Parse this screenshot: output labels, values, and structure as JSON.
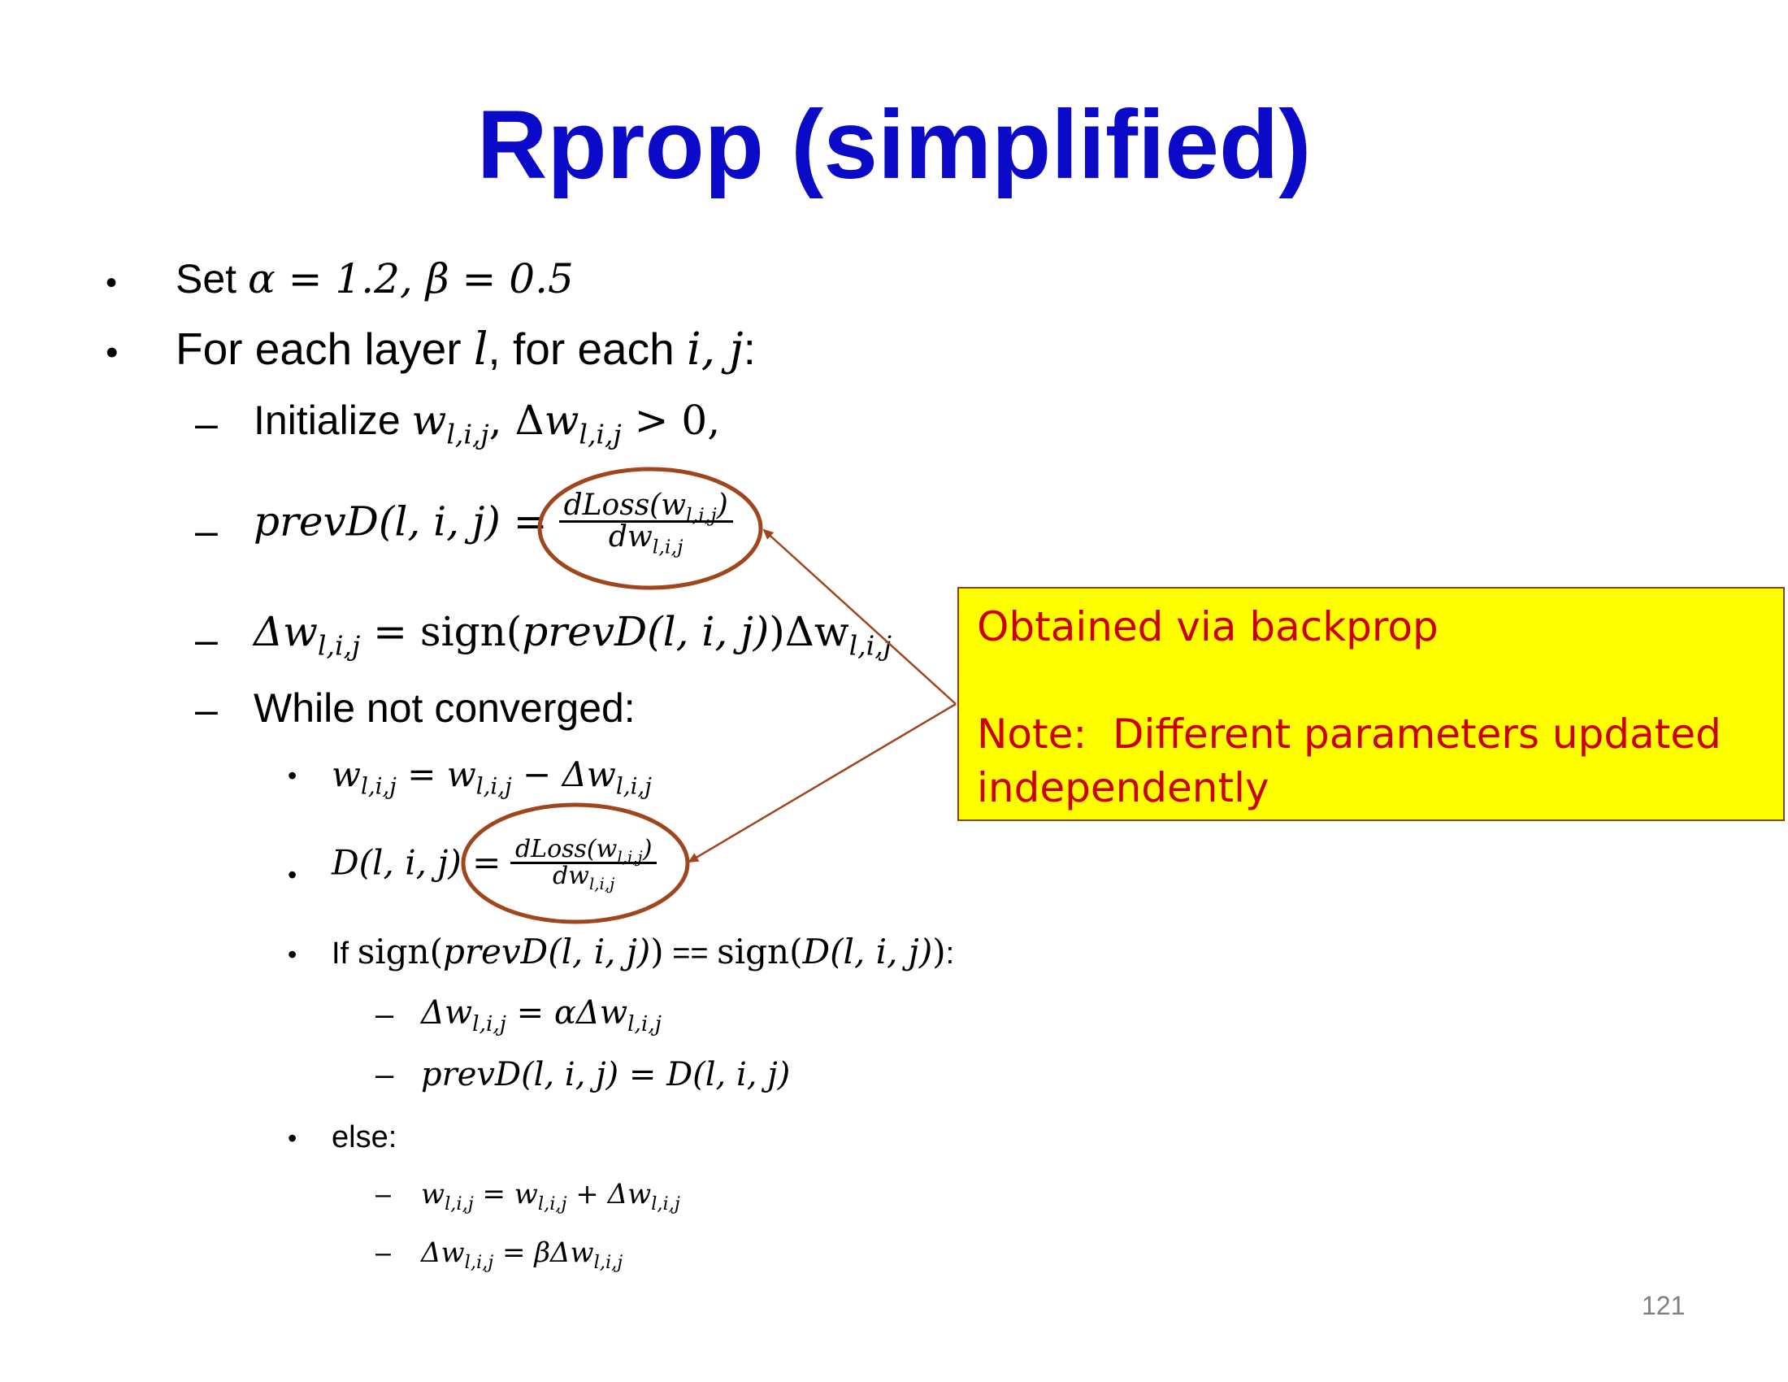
{
  "title": "Rprop (simplified)",
  "bullet_symbol": "•",
  "dash_symbol": "–",
  "lines": {
    "l1_prefix": "Set ",
    "l1_math": "α = 1.2, β = 0.5",
    "l2_a": "For each layer ",
    "l2_b": "l",
    "l2_c": ", for each ",
    "l2_d": "i, j",
    "l2_e": ":",
    "l3_prefix": "Initialize ",
    "l3_w": "w",
    "l3_sep": ", Δ",
    "l3_w2": "w",
    "l3_tail": " > 0,",
    "lij": "l,i,j",
    "l4_left": "prevD(l, i, j) =",
    "frac_num_a": "dLoss(w",
    "frac_num_b": ")",
    "frac_den": "dw",
    "l5_a": "Δw",
    "l5_b": " = sign(",
    "l5_c": "prevD(l, i, j)",
    "l5_d": ")Δw",
    "l6": "While not converged:",
    "l7_a": "w",
    "l7_b": " = w",
    "l7_c": " − Δw",
    "l8_left": "D(l, i, j) =",
    "l9_a": "If ",
    "l9_b": "sign(",
    "l9_c": "prevD(l, i, j)",
    "l9_d": ")",
    "l9_e": " == ",
    "l9_f": "sign(",
    "l9_g": "D(l, i, j)",
    "l9_h": ")",
    "l9_i": ":",
    "l10_a": "Δw",
    "l10_b": " = αΔw",
    "l11": "prevD(l, i, j) = D(l, i, j)",
    "l12": "else:",
    "l13_a": "w",
    "l13_b": " = w",
    "l13_c": " + Δw",
    "l14_a": "Δw",
    "l14_b": " = βΔw"
  },
  "callout": {
    "line1": "Obtained via backprop",
    "line2": "Note:  Different parameters updated",
    "line3": "independently"
  },
  "page_number": "121",
  "colors": {
    "title": "#0a0ac8",
    "callout_bg": "#ffff00",
    "callout_text": "#cc0000",
    "ellipse_stroke": "#a0461e",
    "arrow": "#a0461e"
  }
}
